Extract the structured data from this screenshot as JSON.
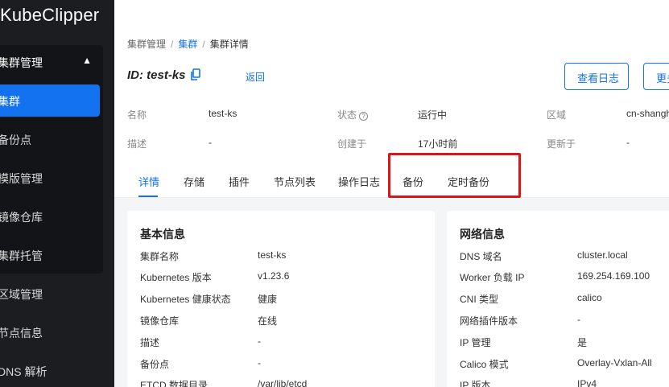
{
  "sidebar": {
    "brand": "KubeClipper",
    "group": {
      "label": "集群管理",
      "chevron": "▲"
    },
    "items": [
      {
        "label": "集群",
        "active": true
      },
      {
        "label": "备份点"
      },
      {
        "label": "模版管理"
      },
      {
        "label": "镜像仓库"
      },
      {
        "label": "集群托管"
      },
      {
        "label": "区域管理"
      },
      {
        "label": "节点信息"
      },
      {
        "label": "DNS 解析"
      }
    ]
  },
  "breadcrumb": {
    "root": "集群管理",
    "link": "集群",
    "current": "集群详情",
    "separator": "/"
  },
  "header": {
    "id_label": "ID:",
    "id_value": "test-ks",
    "back": "返回",
    "view_logs": "查看日志",
    "more": "更多"
  },
  "info": {
    "name_label": "名称",
    "name_value": "test-ks",
    "status_label": "状态",
    "status_value": "运行中",
    "region_label": "区域",
    "region_value": "cn-shanghai",
    "desc_label": "描述",
    "desc_value": "-",
    "created_label": "创建于",
    "created_value": "17小时前",
    "updated_label": "更新于",
    "updated_value": "-"
  },
  "tabs": [
    "详情",
    "存储",
    "插件",
    "节点列表",
    "操作日志",
    "备份",
    "定时备份"
  ],
  "basic_info": {
    "title": "基本信息",
    "rows": [
      {
        "label": "集群名称",
        "value": "test-ks"
      },
      {
        "label": "Kubernetes 版本",
        "value": "v1.23.6"
      },
      {
        "label": "Kubernetes 健康状态",
        "value": "健康"
      },
      {
        "label": "镜像仓库",
        "value": "在线"
      },
      {
        "label": "描述",
        "value": "-"
      },
      {
        "label": "备份点",
        "value": "-"
      },
      {
        "label": "ETCD 数据目录",
        "value": "/var/lib/etcd"
      }
    ]
  },
  "network_info": {
    "title": "网络信息",
    "rows": [
      {
        "label": "DNS 域名",
        "value": "cluster.local"
      },
      {
        "label": "Worker 负载 IP",
        "value": "169.254.169.100"
      },
      {
        "label": "CNI 类型",
        "value": "calico"
      },
      {
        "label": "网络插件版本",
        "value": "-"
      },
      {
        "label": "IP 管理",
        "value": "是"
      },
      {
        "label": "Calico 模式",
        "value": "Overlay-Vxlan-All"
      },
      {
        "label": "IP 版本",
        "value": "IPv4"
      }
    ]
  },
  "colors": {
    "accent": "#1272f0",
    "sidebar": "#1c1d21",
    "highlight": "#d9161c"
  }
}
